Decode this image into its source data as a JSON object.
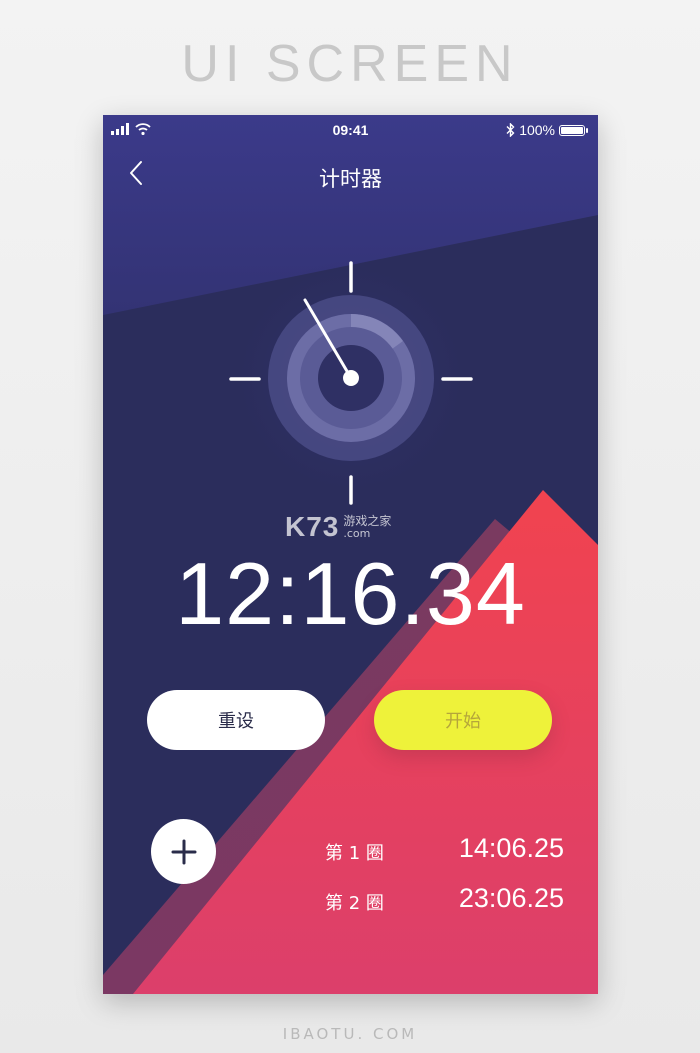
{
  "banner": {
    "title": "UI SCREEN",
    "footer": "IBAOTU. COM"
  },
  "status_bar": {
    "time": "09:41",
    "battery": "100%"
  },
  "nav": {
    "title": "计时器",
    "back_icon": "chevron-left-icon"
  },
  "watermark": {
    "logo": "K73",
    "text": "游戏之家",
    "domain": ".com"
  },
  "timer": {
    "display": "12:16.34"
  },
  "buttons": {
    "reset": "重设",
    "start": "开始",
    "add_icon": "plus-icon"
  },
  "laps": [
    {
      "label": "第 1 圈",
      "time": "14:06.25"
    },
    {
      "label": "第 2 圈",
      "time": "23:06.25"
    }
  ],
  "colors": {
    "background_top": "#3a3a86",
    "background_bottom": "#2a2c5a",
    "accent_red": "#ef4456",
    "accent_pink": "#e0416a",
    "start_button": "#eef23a",
    "reset_button": "#ffffff"
  }
}
